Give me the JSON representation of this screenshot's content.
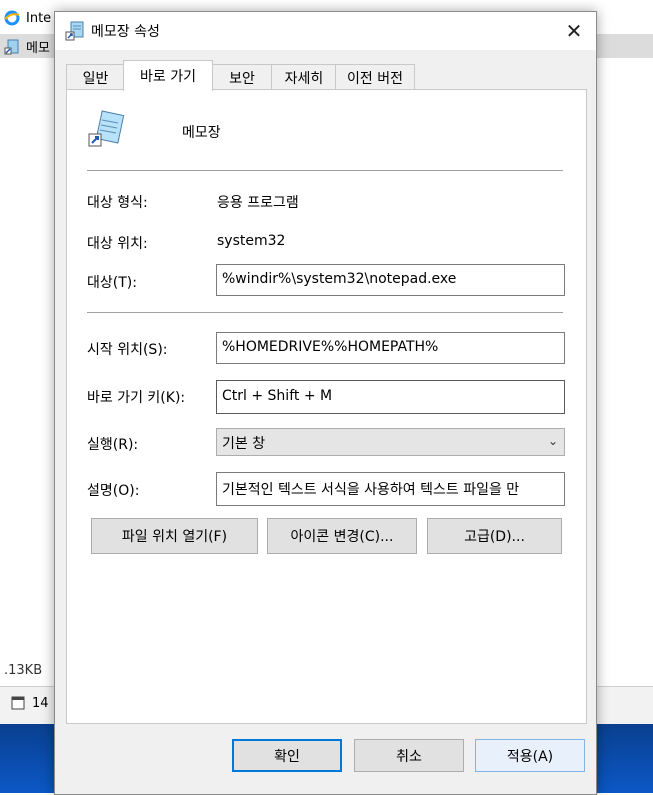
{
  "background": {
    "items": [
      {
        "label": "Inte",
        "icon": "ie-icon"
      },
      {
        "label": "메모",
        "icon": "notepad-icon"
      }
    ],
    "size_text": ".13KB",
    "status_text": "14"
  },
  "dialog": {
    "title": "메모장 속성",
    "close_glyph": "✕",
    "tabs": [
      "일반",
      "바로 가기",
      "보안",
      "자세히",
      "이전 버전"
    ],
    "active_tab": "바로 가기",
    "app_name": "메모장",
    "fields": {
      "target_type_label": "대상 형식:",
      "target_type_value": "응용 프로그램",
      "target_location_label": "대상 위치:",
      "target_location_value": "system32",
      "target_label": "대상(T):",
      "target_value": "%windir%\\system32\\notepad.exe",
      "start_in_label": "시작 위치(S):",
      "start_in_value": "%HOMEDRIVE%%HOMEPATH%",
      "shortcut_key_label": "바로 가기 키(K):",
      "shortcut_key_value": "Ctrl + Shift + M",
      "run_label": "실행(R):",
      "run_value": "기본 창",
      "comment_label": "설명(O):",
      "comment_value": "기본적인 텍스트 서식을 사용하여 텍스트 파일을 만"
    },
    "buttons": {
      "open_location": "파일 위치 열기(F)",
      "change_icon": "아이콘 변경(C)...",
      "advanced": "고급(D)..."
    },
    "footer": {
      "ok": "확인",
      "cancel": "취소",
      "apply": "적용(A)"
    }
  }
}
